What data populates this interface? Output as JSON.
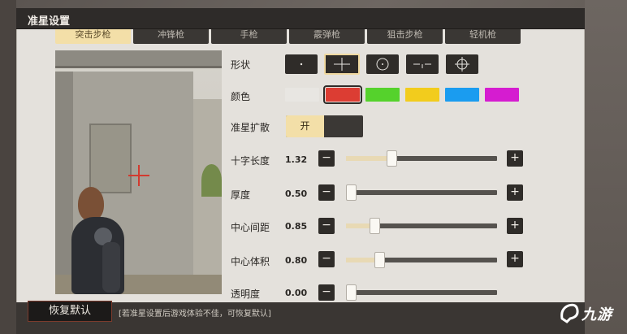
{
  "window": {
    "title": "准星设置"
  },
  "weapon_tabs": [
    {
      "label": "突击步枪",
      "active": true
    },
    {
      "label": "冲锋枪",
      "active": false
    },
    {
      "label": "手枪",
      "active": false
    },
    {
      "label": "霰弹枪",
      "active": false
    },
    {
      "label": "狙击步枪",
      "active": false
    },
    {
      "label": "轻机枪",
      "active": false
    }
  ],
  "settings": {
    "shape": {
      "label": "形状",
      "options": [
        "dot-icon",
        "cross-icon",
        "circle-dot-icon",
        "gap-cross-icon",
        "circle-cross-icon"
      ],
      "selected_index": 1
    },
    "color": {
      "label": "颜色",
      "options": [
        "#e8e6e2",
        "#dc3d33",
        "#55d22c",
        "#f2cc1d",
        "#1a9cf0",
        "#d51cd0"
      ],
      "selected_index": 1
    },
    "spread": {
      "label": "准星扩散",
      "on_label": "开"
    },
    "sliders": [
      {
        "label": "十字长度",
        "value": "1.32",
        "fraction": 0.29
      },
      {
        "label": "厚度",
        "value": "0.50",
        "fraction": 0.0
      },
      {
        "label": "中心间距",
        "value": "0.85",
        "fraction": 0.17
      },
      {
        "label": "中心体积",
        "value": "0.80",
        "fraction": 0.2
      },
      {
        "label": "透明度",
        "value": "0.00",
        "fraction": 0.0
      }
    ],
    "minus_glyph": "−",
    "plus_glyph": "+"
  },
  "footer": {
    "reset_label": "恢复默认",
    "note": "[若准星设置后游戏体验不佳，可恢复默认]"
  },
  "watermark": {
    "text": "九游"
  }
}
